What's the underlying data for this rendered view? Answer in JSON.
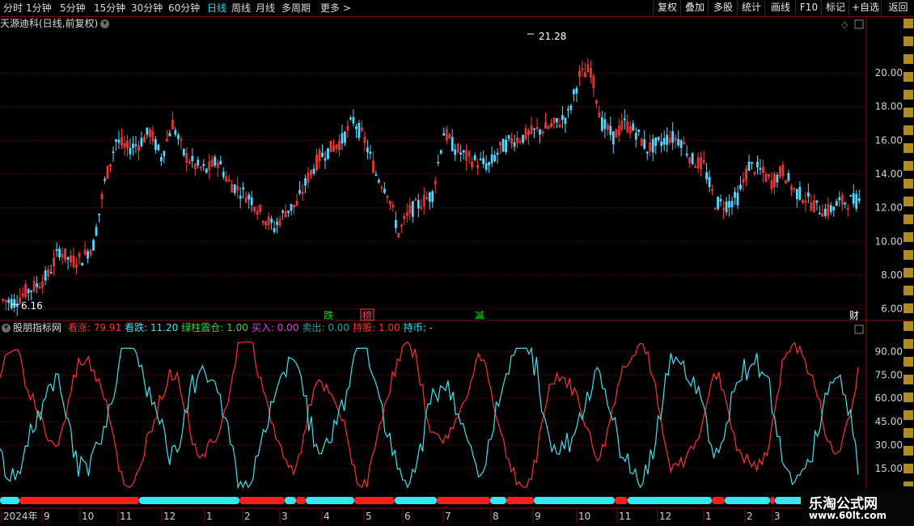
{
  "toolbar": {
    "periods": [
      "分时",
      "1分钟",
      "5分钟",
      "15分钟",
      "30分钟",
      "60分钟",
      "日线",
      "周线",
      "月线",
      "多周期",
      "更多 >"
    ],
    "active_period": "日线",
    "buttons": [
      "复权",
      "叠加",
      "多股",
      "统计",
      "画线",
      "F10",
      "标记",
      "+自选",
      "返回"
    ]
  },
  "main_chart": {
    "title": "天源迪科(日线,前复权)",
    "high_label": "21.28",
    "low_label": "6.16",
    "y_ticks": [
      "20.00",
      "18.00",
      "16.00",
      "14.00",
      "12.00",
      "10.00",
      "8.00",
      "6.00"
    ],
    "markers": [
      {
        "text": "跌",
        "color": "#00e000"
      },
      {
        "text": "榜",
        "color": "#ff4040"
      },
      {
        "text": "减",
        "color": "#00e000"
      },
      {
        "text": "财",
        "color": "#ffffff"
      }
    ]
  },
  "indicator": {
    "name": "股朋指标网",
    "fields": [
      {
        "label": "看涨:",
        "value": "79.91",
        "color": "#ff3030"
      },
      {
        "label": "看跌:",
        "value": "11.20",
        "color": "#40e0f0"
      },
      {
        "label": "绿柱震仓:",
        "value": "1.00",
        "color": "#40d040"
      },
      {
        "label": "买入:",
        "value": "0.00",
        "color": "#e040e0"
      },
      {
        "label": "卖出:",
        "value": "0.00",
        "color": "#2aa0a0"
      },
      {
        "label": "持股:",
        "value": "1.00",
        "color": "#ff3030"
      },
      {
        "label": "持币:",
        "value": "-",
        "color": "#40e0f0"
      }
    ],
    "y_ticks": [
      "90.00",
      "75.00",
      "60.00",
      "45.00",
      "30.00",
      "15.00"
    ]
  },
  "x_axis": {
    "labels": [
      "2024年",
      "9",
      "10",
      "11",
      "12",
      "1",
      "2",
      "3",
      "4",
      "5",
      "6",
      "7",
      "8",
      "9",
      "10",
      "11",
      "12",
      "1",
      "2",
      "3"
    ]
  },
  "watermark": {
    "line1": "乐淘公式网",
    "line2": "www.60lt.com"
  },
  "chart_data": [
    {
      "type": "candlestick",
      "title": "天源迪科(日线,前复权)",
      "ylim": [
        5.5,
        22.5
      ],
      "annotations": [
        "21.28",
        "6.16"
      ],
      "close_approx": [
        6.5,
        6.4,
        7.0,
        7.4,
        8.0,
        9.5,
        8.8,
        9.0,
        9.8,
        13.5,
        16.0,
        15.5,
        15.8,
        16.5,
        15.0,
        17.0,
        15.2,
        14.5,
        14.2,
        14.8,
        13.5,
        13.0,
        12.5,
        11.5,
        10.8,
        11.8,
        12.2,
        13.8,
        15.0,
        15.5,
        16.0,
        17.2,
        16.0,
        14.0,
        13.0,
        10.5,
        11.8,
        12.3,
        12.8,
        16.5,
        15.5,
        15.0,
        14.7,
        14.5,
        15.5,
        16.0,
        16.2,
        16.5,
        16.7,
        17.0,
        17.5,
        19.8,
        20.2,
        17.0,
        16.2,
        17.0,
        16.5,
        15.5,
        15.8,
        16.2,
        16.0,
        14.8,
        14.5,
        12.3,
        12.2,
        12.6,
        14.5,
        14.2,
        13.5,
        14.2,
        13.0,
        12.6,
        12.0,
        11.8,
        12.3,
        12.4
      ]
    },
    {
      "type": "line",
      "title": "股朋指标网",
      "ylim": [
        0,
        100
      ],
      "series": [
        {
          "name": "看涨",
          "color": "#ff3030",
          "last": 79.91
        },
        {
          "name": "看跌",
          "color": "#40e0f0",
          "last": 11.2
        }
      ]
    }
  ]
}
